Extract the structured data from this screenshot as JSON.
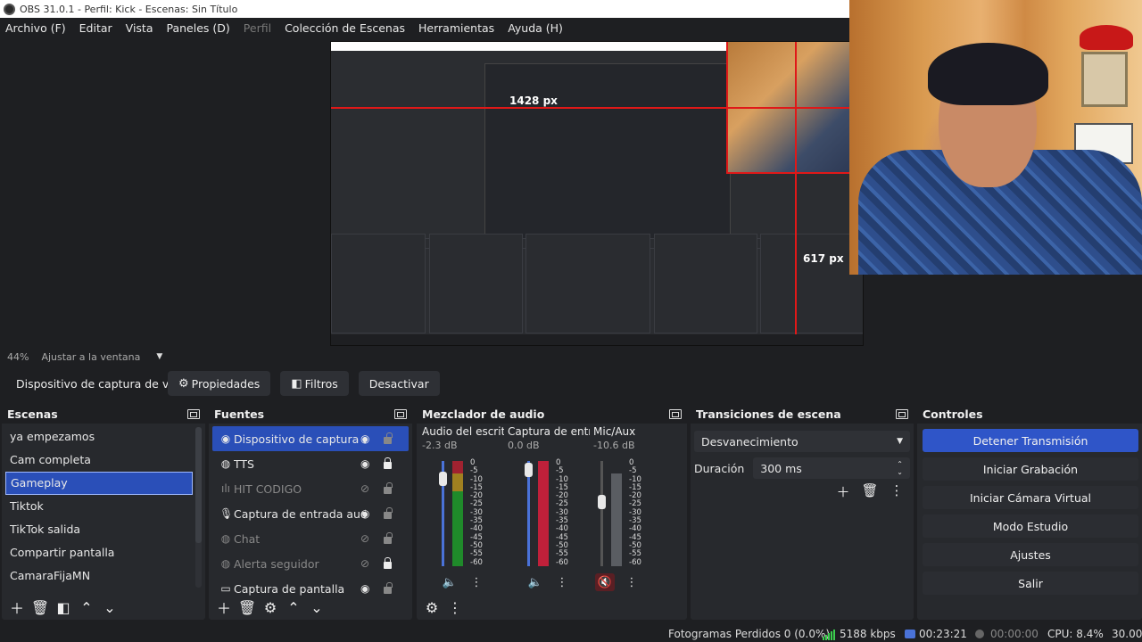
{
  "window": {
    "title": "OBS 31.0.1 - Perfil: Kick - Escenas: Sin Título"
  },
  "menu": [
    "Archivo (F)",
    "Editar",
    "Vista",
    "Paneles (D)",
    "Perfil",
    "Colección de Escenas",
    "Herramientas",
    "Ayuda (H)"
  ],
  "preview": {
    "measure_horizontal": "1428 px",
    "measure_vertical": "617 px"
  },
  "zoom": {
    "level": "44%",
    "mode": "Ajustar a la ventana"
  },
  "source_toolbar": {
    "source_name": "Dispositivo de captura de v",
    "properties": "Propiedades",
    "filters": "Filtros",
    "deactivate": "Desactivar"
  },
  "scenes": {
    "title": "Escenas",
    "items": [
      "ya empezamos",
      "Cam completa",
      "Gameplay",
      "Tiktok",
      "TikTok salida",
      "Compartir pantalla",
      "CamaraFijaMN"
    ],
    "selected": "Gameplay"
  },
  "sources": {
    "title": "Fuentes",
    "items": [
      {
        "name": "Dispositivo de captura de v",
        "icon": "camera-icon",
        "visible": true,
        "locked": false,
        "selected": true
      },
      {
        "name": "TTS",
        "icon": "globe-icon",
        "visible": true,
        "locked": true
      },
      {
        "name": "HIT CODIGO",
        "icon": "audio-bars-icon",
        "visible": false,
        "locked": false
      },
      {
        "name": "Captura de entrada audio",
        "icon": "microphone-icon",
        "visible": true,
        "locked": false
      },
      {
        "name": "Chat",
        "icon": "globe-icon",
        "visible": false,
        "locked": false
      },
      {
        "name": "Alerta seguidor",
        "icon": "globe-icon",
        "visible": false,
        "locked": true
      },
      {
        "name": "Captura de pantalla",
        "icon": "monitor-icon",
        "visible": true,
        "locked": false
      }
    ]
  },
  "mixer": {
    "title": "Mezclador de audio",
    "scale": [
      "0",
      "-5",
      "-10",
      "-15",
      "-20",
      "-25",
      "-30",
      "-35",
      "-40",
      "-45",
      "-50",
      "-55",
      "-60"
    ],
    "channels": [
      {
        "name": "Audio del escritc",
        "db": "-2.3 dB",
        "fader": 0.85,
        "muted": false
      },
      {
        "name": "Captura de entra",
        "db": "0.0 dB",
        "fader": 0.95,
        "muted": false
      },
      {
        "name": "Mic/Aux",
        "db": "-10.6 dB",
        "fader": 0.65,
        "muted": true
      }
    ]
  },
  "transitions": {
    "title": "Transiciones de escena",
    "selected": "Desvanecimiento",
    "duration_label": "Duración",
    "duration_value": "300 ms"
  },
  "controls": {
    "title": "Controles",
    "buttons": [
      "Detener Transmisión",
      "Iniciar Grabación",
      "Iniciar Cámara Virtual",
      "Modo Estudio",
      "Ajustes",
      "Salir"
    ]
  },
  "status": {
    "dropped_frames": "Fotogramas Perdidos 0 (0.0%)",
    "bitrate": "5188 kbps",
    "stream_time": "00:23:21",
    "rec_time": "00:00:00",
    "cpu": "CPU: 8.4%",
    "fps": "30.00"
  },
  "colors": {
    "accent": "#2f55c8",
    "selected": "#2a4fb8",
    "measure": "#e01818",
    "signal": "#3ccf4e"
  }
}
